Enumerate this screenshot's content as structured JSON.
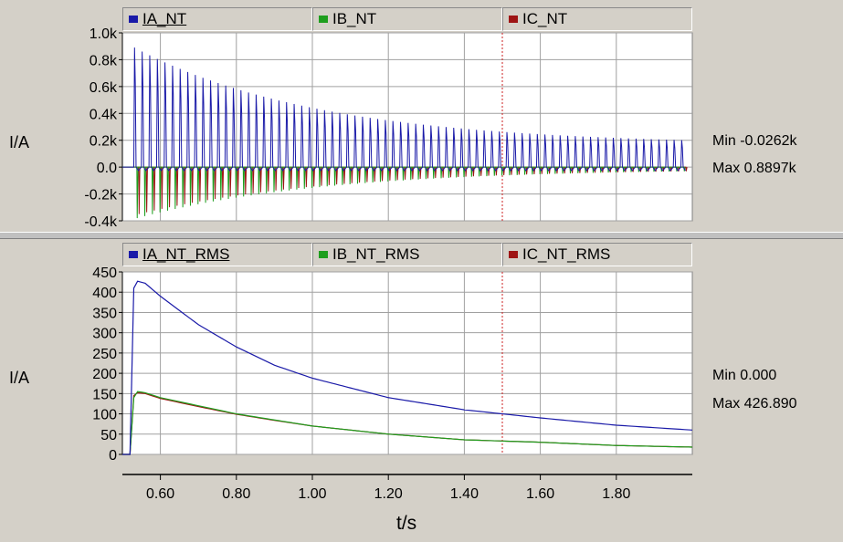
{
  "colors": {
    "ia": "#1a1aa8",
    "ib": "#1e9e1e",
    "ic": "#9e1414",
    "cursor": "#cc2020",
    "grid": "#a0a0a0"
  },
  "panels": [
    {
      "legend": [
        "IA_NT",
        "IB_NT",
        "IC_NT"
      ],
      "ylabel": "I/A",
      "min_label": "Min -0.0262k",
      "max_label": "Max 0.8897k"
    },
    {
      "legend": [
        "IA_NT_RMS",
        "IB_NT_RMS",
        "IC_NT_RMS"
      ],
      "ylabel": "I/A",
      "min_label": "Min 0.000",
      "max_label": "Max 426.890"
    }
  ],
  "xlabel": "t/s",
  "chart_data": [
    {
      "type": "line",
      "ylabel": "I/A",
      "xlim": [
        0.5,
        2.0
      ],
      "ylim": [
        -0.4,
        1.0
      ],
      "yticks": [
        "1.0k",
        "0.8k",
        "0.6k",
        "0.4k",
        "0.2k",
        "0.0",
        "-0.2k",
        "-0.4k"
      ],
      "ytick_values": [
        1.0,
        0.8,
        0.6,
        0.4,
        0.2,
        0.0,
        -0.2,
        -0.4
      ],
      "cursor_x": 1.5,
      "series": [
        {
          "name": "IA_NT",
          "peak_start": 0.89,
          "peak_end": 0.2,
          "trough": -0.026
        },
        {
          "name": "IB_NT",
          "peak": 0.0,
          "trough_start": -0.38,
          "trough_end": -0.03
        },
        {
          "name": "IC_NT",
          "peak": 0.0,
          "trough_start": -0.35,
          "trough_end": -0.03
        }
      ],
      "onset_time": 0.53,
      "pulse_period": 0.02
    },
    {
      "type": "line",
      "ylabel": "I/A",
      "xlim": [
        0.5,
        2.0
      ],
      "ylim": [
        0,
        450
      ],
      "yticks": [
        "450",
        "400",
        "350",
        "300",
        "250",
        "200",
        "150",
        "100",
        "50",
        "0"
      ],
      "ytick_values": [
        450,
        400,
        350,
        300,
        250,
        200,
        150,
        100,
        50,
        0
      ],
      "cursor_x": 1.5,
      "series": [
        {
          "name": "IA_NT_RMS",
          "x": [
            0.52,
            0.53,
            0.54,
            0.56,
            0.6,
            0.7,
            0.8,
            0.9,
            1.0,
            1.2,
            1.4,
            1.6,
            1.8,
            2.0
          ],
          "y": [
            0,
            410,
            427,
            422,
            390,
            320,
            265,
            220,
            188,
            140,
            110,
            90,
            72,
            60
          ]
        },
        {
          "name": "IB_NT_RMS",
          "x": [
            0.52,
            0.53,
            0.54,
            0.56,
            0.6,
            0.7,
            0.8,
            0.9,
            1.0,
            1.2,
            1.4,
            1.6,
            1.8,
            2.0
          ],
          "y": [
            0,
            140,
            155,
            152,
            140,
            120,
            100,
            85,
            70,
            50,
            36,
            30,
            22,
            18
          ]
        },
        {
          "name": "IC_NT_RMS",
          "x": [
            0.52,
            0.53,
            0.54,
            0.56,
            0.6,
            0.7,
            0.8,
            0.9,
            1.0,
            1.2,
            1.4,
            1.6,
            1.8,
            2.0
          ],
          "y": [
            0,
            145,
            152,
            150,
            138,
            118,
            99,
            84,
            70,
            50,
            36,
            30,
            22,
            18
          ]
        }
      ]
    }
  ],
  "xticks": [
    "0.60",
    "0.80",
    "1.00",
    "1.20",
    "1.40",
    "1.60",
    "1.80"
  ],
  "xtick_values": [
    0.6,
    0.8,
    1.0,
    1.2,
    1.4,
    1.6,
    1.8
  ]
}
